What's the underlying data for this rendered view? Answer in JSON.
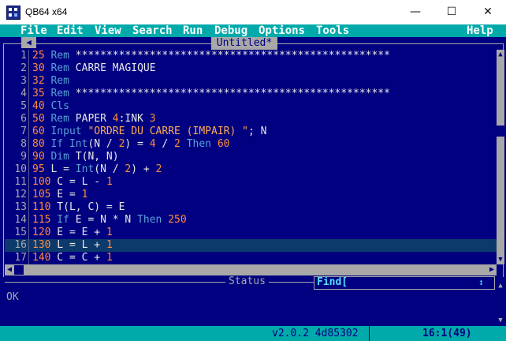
{
  "window": {
    "title": "QB64 x64"
  },
  "titlebar_buttons": {
    "minimize": "—",
    "maximize": "☐",
    "close": "✕"
  },
  "menu": [
    "File",
    "Edit",
    "View",
    "Search",
    "Run",
    "Debug",
    "Options",
    "Tools",
    "Help"
  ],
  "editor": {
    "tab_title": "Untitled*",
    "current_line": 16,
    "lines": [
      {
        "n": "1",
        "segs": [
          [
            "num",
            "25"
          ],
          [
            "kw",
            " Rem "
          ],
          [
            "txt",
            "***************************************************"
          ]
        ]
      },
      {
        "n": "2",
        "segs": [
          [
            "num",
            "30"
          ],
          [
            "kw",
            " Rem "
          ],
          [
            "txt",
            "CARRE MAGIQUE"
          ]
        ]
      },
      {
        "n": "3",
        "segs": [
          [
            "num",
            "32"
          ],
          [
            "kw",
            " Rem"
          ]
        ]
      },
      {
        "n": "4",
        "segs": [
          [
            "num",
            "35"
          ],
          [
            "kw",
            " Rem "
          ],
          [
            "txt",
            "***************************************************"
          ]
        ]
      },
      {
        "n": "5",
        "segs": [
          [
            "num",
            "40"
          ],
          [
            "kw",
            " Cls"
          ]
        ]
      },
      {
        "n": "6",
        "segs": [
          [
            "num",
            "50"
          ],
          [
            "kw",
            " Rem "
          ],
          [
            "txt",
            "PAPER "
          ],
          [
            "num",
            "4"
          ],
          [
            "txt",
            ":INK "
          ],
          [
            "num",
            "3"
          ]
        ]
      },
      {
        "n": "7",
        "segs": [
          [
            "num",
            "60"
          ],
          [
            "kw",
            " Input "
          ],
          [
            "str",
            "\"ORDRE DU CARRE (IMPAIR) \""
          ],
          [
            "txt",
            "; N"
          ]
        ]
      },
      {
        "n": "8",
        "segs": [
          [
            "num",
            "80"
          ],
          [
            "kw",
            " If Int"
          ],
          [
            "txt",
            "(N / "
          ],
          [
            "num",
            "2"
          ],
          [
            "txt",
            ") = "
          ],
          [
            "num",
            "4"
          ],
          [
            "txt",
            " / "
          ],
          [
            "num",
            "2"
          ],
          [
            "kw",
            " Then "
          ],
          [
            "num",
            "60"
          ]
        ]
      },
      {
        "n": "9",
        "segs": [
          [
            "num",
            "90"
          ],
          [
            "kw",
            " Dim "
          ],
          [
            "txt",
            "T(N, N)"
          ]
        ]
      },
      {
        "n": "10",
        "segs": [
          [
            "num",
            "95"
          ],
          [
            "txt",
            " L = "
          ],
          [
            "kw",
            "Int"
          ],
          [
            "txt",
            "(N / "
          ],
          [
            "num",
            "2"
          ],
          [
            "txt",
            ") + "
          ],
          [
            "num",
            "2"
          ]
        ]
      },
      {
        "n": "11",
        "segs": [
          [
            "num",
            "100"
          ],
          [
            "txt",
            " C = L - "
          ],
          [
            "num",
            "1"
          ]
        ]
      },
      {
        "n": "12",
        "segs": [
          [
            "num",
            "105"
          ],
          [
            "txt",
            " E = "
          ],
          [
            "num",
            "1"
          ]
        ]
      },
      {
        "n": "13",
        "segs": [
          [
            "num",
            "110"
          ],
          [
            "txt",
            " T(L, C) = E"
          ]
        ]
      },
      {
        "n": "14",
        "segs": [
          [
            "num",
            "115"
          ],
          [
            "kw",
            " If "
          ],
          [
            "txt",
            "E = N * N"
          ],
          [
            "kw",
            " Then "
          ],
          [
            "num",
            "250"
          ]
        ]
      },
      {
        "n": "15",
        "segs": [
          [
            "num",
            "120"
          ],
          [
            "txt",
            " E = E + "
          ],
          [
            "num",
            "1"
          ]
        ]
      },
      {
        "n": "16",
        "segs": [
          [
            "num",
            "130"
          ],
          [
            "txt",
            " L = L + "
          ],
          [
            "num",
            "1"
          ]
        ]
      },
      {
        "n": "17",
        "segs": [
          [
            "num",
            "140"
          ],
          [
            "txt",
            " C = C + "
          ],
          [
            "num",
            "1"
          ]
        ]
      }
    ]
  },
  "status": {
    "label": "Status",
    "message": "OK"
  },
  "find": {
    "label": "Find["
  },
  "bottombar": {
    "version": "v2.0.2 4d85302",
    "position": "16:1(49)"
  }
}
